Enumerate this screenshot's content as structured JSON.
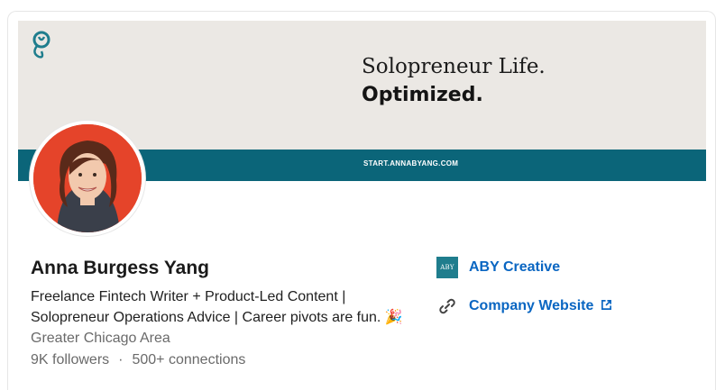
{
  "banner": {
    "line1": "Solopreneur Life.",
    "line2": "Optimized.",
    "url": "START.ANNABYANG.COM",
    "colors": {
      "background": "#ebe8e4",
      "strip": "#0b6579",
      "logo": "#1f7d8d"
    }
  },
  "profile": {
    "name": "Anna Burgess Yang",
    "headline_line1": "Freelance Fintech Writer + Product-Led Content |",
    "headline_line2": "Solopreneur Operations Advice | Career pivots are fun.",
    "headline_emoji": "🎉",
    "location": "Greater Chicago Area",
    "followers": "9K followers",
    "separator": "·",
    "connections": "500+ connections",
    "avatar_background": "#e5442a"
  },
  "side": {
    "company_logo_text": "ABY",
    "company_name": "ABY Creative",
    "website_label": "Company Website",
    "link_color": "#0a66c2",
    "icons": [
      "link-icon",
      "external-link-icon"
    ]
  }
}
